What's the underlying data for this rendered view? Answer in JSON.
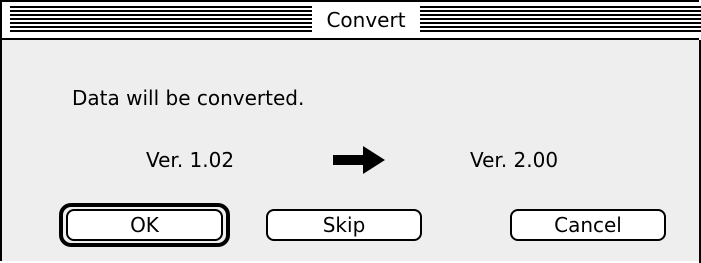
{
  "window": {
    "title": "Convert"
  },
  "dialog": {
    "message": "Data will be converted.",
    "from_version": "Ver. 1.02",
    "to_version": "Ver. 2.00",
    "arrow_icon": "right-arrow-icon"
  },
  "buttons": {
    "ok_label": "OK",
    "skip_label": "Skip",
    "cancel_label": "Cancel"
  },
  "colors": {
    "background": "#eeeeee",
    "text": "#000000",
    "button_face": "#ffffff"
  }
}
